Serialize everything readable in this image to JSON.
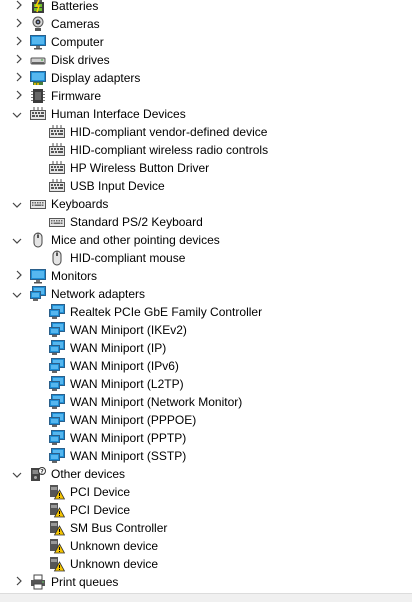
{
  "tree": [
    {
      "label": "Batteries",
      "level": 0,
      "state": "collapsed",
      "icon": "battery-icon"
    },
    {
      "label": "Cameras",
      "level": 0,
      "state": "collapsed",
      "icon": "camera-icon"
    },
    {
      "label": "Computer",
      "level": 0,
      "state": "collapsed",
      "icon": "monitor-icon"
    },
    {
      "label": "Disk drives",
      "level": 0,
      "state": "collapsed",
      "icon": "disk-drive-icon"
    },
    {
      "label": "Display adapters",
      "level": 0,
      "state": "collapsed",
      "icon": "display-adapter-icon"
    },
    {
      "label": "Firmware",
      "level": 0,
      "state": "collapsed",
      "icon": "firmware-icon"
    },
    {
      "label": "Human Interface Devices",
      "level": 0,
      "state": "expanded",
      "icon": "hid-icon"
    },
    {
      "label": "HID-compliant vendor-defined device",
      "level": 1,
      "state": "none",
      "icon": "hid-icon"
    },
    {
      "label": "HID-compliant wireless radio controls",
      "level": 1,
      "state": "none",
      "icon": "hid-icon"
    },
    {
      "label": "HP Wireless Button Driver",
      "level": 1,
      "state": "none",
      "icon": "hid-icon"
    },
    {
      "label": "USB Input Device",
      "level": 1,
      "state": "none",
      "icon": "hid-icon"
    },
    {
      "label": "Keyboards",
      "level": 0,
      "state": "expanded",
      "icon": "keyboard-icon"
    },
    {
      "label": "Standard PS/2 Keyboard",
      "level": 1,
      "state": "none",
      "icon": "keyboard-icon"
    },
    {
      "label": "Mice and other pointing devices",
      "level": 0,
      "state": "expanded",
      "icon": "mouse-icon"
    },
    {
      "label": "HID-compliant mouse",
      "level": 1,
      "state": "none",
      "icon": "mouse-icon"
    },
    {
      "label": "Monitors",
      "level": 0,
      "state": "collapsed",
      "icon": "monitor-icon"
    },
    {
      "label": "Network adapters",
      "level": 0,
      "state": "expanded",
      "icon": "network-adapter-icon"
    },
    {
      "label": "Realtek PCIe GbE Family Controller",
      "level": 1,
      "state": "none",
      "icon": "network-adapter-icon"
    },
    {
      "label": "WAN Miniport (IKEv2)",
      "level": 1,
      "state": "none",
      "icon": "network-adapter-icon"
    },
    {
      "label": "WAN Miniport (IP)",
      "level": 1,
      "state": "none",
      "icon": "network-adapter-icon"
    },
    {
      "label": "WAN Miniport (IPv6)",
      "level": 1,
      "state": "none",
      "icon": "network-adapter-icon"
    },
    {
      "label": "WAN Miniport (L2TP)",
      "level": 1,
      "state": "none",
      "icon": "network-adapter-icon"
    },
    {
      "label": "WAN Miniport (Network Monitor)",
      "level": 1,
      "state": "none",
      "icon": "network-adapter-icon"
    },
    {
      "label": "WAN Miniport (PPPOE)",
      "level": 1,
      "state": "none",
      "icon": "network-adapter-icon"
    },
    {
      "label": "WAN Miniport (PPTP)",
      "level": 1,
      "state": "none",
      "icon": "network-adapter-icon"
    },
    {
      "label": "WAN Miniport (SSTP)",
      "level": 1,
      "state": "none",
      "icon": "network-adapter-icon"
    },
    {
      "label": "Other devices",
      "level": 0,
      "state": "expanded",
      "icon": "other-devices-icon"
    },
    {
      "label": "PCI Device",
      "level": 1,
      "state": "none",
      "icon": "warning-device-icon"
    },
    {
      "label": "PCI Device",
      "level": 1,
      "state": "none",
      "icon": "warning-device-icon"
    },
    {
      "label": "SM Bus Controller",
      "level": 1,
      "state": "none",
      "icon": "warning-device-icon"
    },
    {
      "label": "Unknown device",
      "level": 1,
      "state": "none",
      "icon": "warning-device-icon"
    },
    {
      "label": "Unknown device",
      "level": 1,
      "state": "none",
      "icon": "warning-device-icon"
    },
    {
      "label": "Print queues",
      "level": 0,
      "state": "collapsed",
      "icon": "printer-icon"
    }
  ],
  "colors": {
    "text": "#000000",
    "background": "#ffffff",
    "monitor_blue": "#1e8fd6",
    "warning_yellow": "#f5c400"
  }
}
